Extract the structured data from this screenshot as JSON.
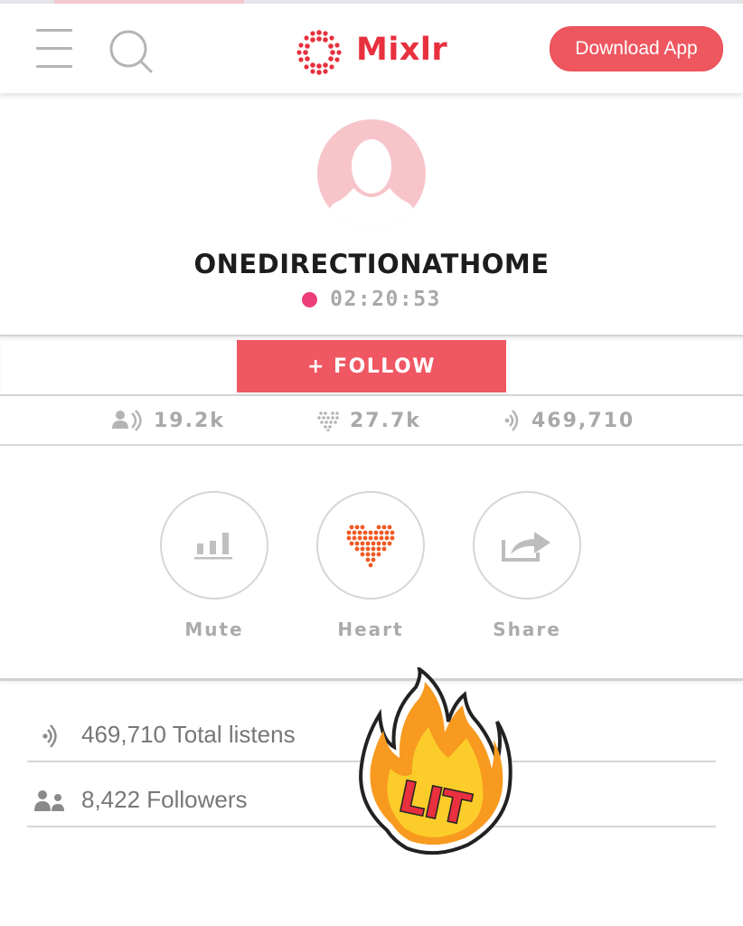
{
  "header": {
    "logo_text": "Mixlr",
    "download_label": "Download App"
  },
  "profile": {
    "username": "ONEDIRECTIONATHOME",
    "live_time": "02:20:53",
    "follow_label": "+ FOLLOW"
  },
  "stats": {
    "listeners": "19.2k",
    "hearts": "27.7k",
    "listens": "469,710"
  },
  "actions": {
    "mute": "Mute",
    "heart": "Heart",
    "share": "Share"
  },
  "details": {
    "total_listens": "469,710 Total listens",
    "followers": "8,422 Followers"
  },
  "sticker": {
    "text": "LIT"
  },
  "colors": {
    "brand_red": "#e8303e",
    "button_red": "#ef5762",
    "live_dot": "#ee3e79",
    "heart_orange": "#ef5a24"
  }
}
